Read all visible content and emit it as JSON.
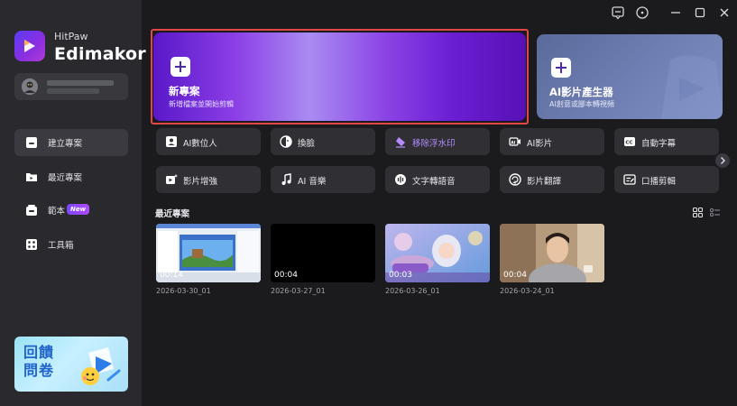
{
  "brand": {
    "small": "HitPaw",
    "big": "Edimakor"
  },
  "sidebar": {
    "items": [
      {
        "label": "建立專案",
        "icon": "home-icon",
        "active": true
      },
      {
        "label": "最近專案",
        "icon": "folder-icon",
        "active": false
      },
      {
        "label": "範本",
        "icon": "template-icon",
        "active": false,
        "badge": "New"
      },
      {
        "label": "工具箱",
        "icon": "toolbox-icon",
        "active": false
      }
    ],
    "feedback_label": "回饋\n問卷"
  },
  "hero": {
    "new_project": {
      "title": "新專案",
      "subtitle": "新增檔案並開始剪輯"
    },
    "ai_generator": {
      "title": "AI影片產生器",
      "subtitle": "AI創意或腳本轉視頻"
    }
  },
  "tools": [
    {
      "label": "AI數位人",
      "icon": "avatar-icon"
    },
    {
      "label": "換臉",
      "icon": "face-swap-icon"
    },
    {
      "label": "移除浮水印",
      "icon": "eraser-icon",
      "highlight": true
    },
    {
      "label": "AI影片",
      "icon": "ai-video-icon"
    },
    {
      "label": "自動字幕",
      "icon": "cc-icon"
    },
    {
      "label": "影片增強",
      "icon": "enhance-icon"
    },
    {
      "label": "AI 音樂",
      "icon": "music-icon"
    },
    {
      "label": "文字轉語音",
      "icon": "tts-icon"
    },
    {
      "label": "影片翻譯",
      "icon": "translate-icon"
    },
    {
      "label": "口播剪輯",
      "icon": "speech-edit-icon"
    }
  ],
  "recent": {
    "title": "最近專案",
    "projects": [
      {
        "duration": "00:14",
        "date": "2026-03-30_01"
      },
      {
        "duration": "00:04",
        "date": "2026-03-27_01"
      },
      {
        "duration": "00:03",
        "date": "2026-03-26_01"
      },
      {
        "duration": "00:04",
        "date": "2026-03-24_01"
      }
    ]
  },
  "colors": {
    "accent_purple": "#7b3fe4",
    "highlight_border": "#e04848",
    "background": "#1b1b1e",
    "sidebar": "#2a2a2e"
  }
}
